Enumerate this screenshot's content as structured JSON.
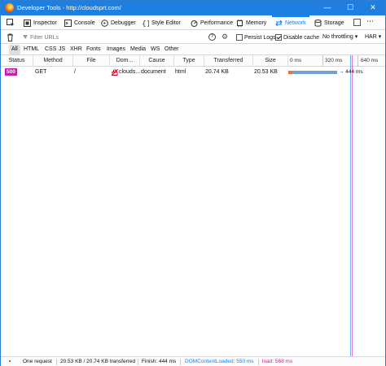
{
  "window": {
    "title": "Developer Tools - http://cloudsprt.com/"
  },
  "controls": {
    "minimize": "—",
    "maximize": "☐",
    "close": "✕"
  },
  "tabs": [
    {
      "label": "Inspector",
      "icon": "inspector-icon"
    },
    {
      "label": "Console",
      "icon": "console-icon"
    },
    {
      "label": "Debugger",
      "icon": "debugger-icon"
    },
    {
      "label": "Style Editor",
      "icon": "style-editor-icon"
    },
    {
      "label": "Performance",
      "icon": "performance-icon"
    },
    {
      "label": "Memory",
      "icon": "memory-icon"
    },
    {
      "label": "Network",
      "icon": "network-icon",
      "active": true
    },
    {
      "label": "Storage",
      "icon": "storage-icon"
    }
  ],
  "filter": {
    "placeholder": "Filter URLs",
    "persist_logs": "Persist Logs",
    "persist_logs_checked": false,
    "disable_cache": "Disable cache",
    "disable_cache_checked": true,
    "throttling": "No throttling",
    "har": "HAR"
  },
  "type_filters": [
    "All",
    "HTML",
    "CSS",
    "JS",
    "XHR",
    "Fonts",
    "Images",
    "Media",
    "WS",
    "Other"
  ],
  "type_filter_selected": "All",
  "columns": [
    "Status",
    "Method",
    "File",
    "Dom...",
    "Cause",
    "Type",
    "Transferred",
    "Size"
  ],
  "waterfall_ticks": [
    "0 ms",
    "320 ms",
    "640 ms"
  ],
  "requests": [
    {
      "status": "500",
      "method": "GET",
      "file": "/",
      "domain": "clouds...",
      "cause": "document",
      "type": "html",
      "transferred": "20.74 KB",
      "size": "20.53 KB",
      "timing_label": "→ 444 ms"
    }
  ],
  "statusbar": {
    "requests": "One request",
    "transferred": "20.53 KB / 20.74 KB transferred",
    "finish": "Finish: 444 ms",
    "dom_content_loaded": "DOMContentLoaded: 550 ms",
    "load": "load: 568 ms"
  },
  "colors": {
    "accent": "#0a84ff",
    "status_error": "#c322a8",
    "dcl_line": "#0a84ff",
    "load_line": "#e0169a",
    "timing_blocked": "#e2763e",
    "timing_wait": "#6fa3d8"
  }
}
